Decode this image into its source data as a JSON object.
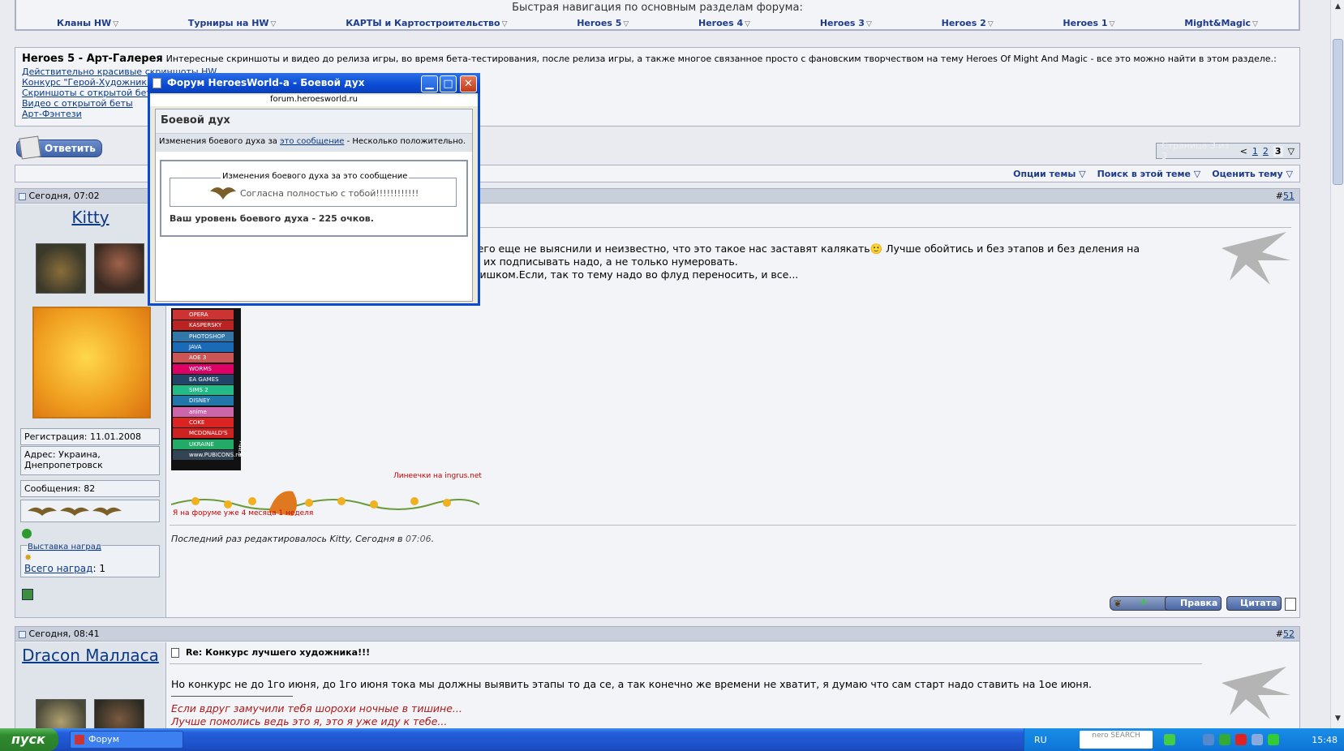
{
  "nav": {
    "title": "Быстрая навигация по основным разделам форума:",
    "links": [
      "Кланы HW",
      "Турниры на HW",
      "КАРТЫ и Картостроительство",
      "Heroes 5",
      "Heroes 4",
      "Heroes 3",
      "Heroes 2",
      "Heroes 1",
      "Might&Magic"
    ]
  },
  "forum": {
    "title": "Heroes 5 - Арт-Галерея",
    "description": "Интересные скриншоты и видео до релиза игры, во время бета-тестирования, после релиза игры, а также многое связанное просто с фановским творчеством на тему Heroes Of Might And Magic - все это можно найти в этом разделе.:",
    "links": [
      "Действительно красивые скриншоты HW",
      "Конкурс \"Герой-Художник\"",
      "Скриншоты с открытой беты",
      "Видео с открытой беты",
      "Арт-Фэнтези"
    ]
  },
  "reply_label": "Ответить",
  "pager": {
    "label": "Страница 3 из 3",
    "prev": "<",
    "pages": [
      "1",
      "2",
      "3"
    ],
    "current": "3"
  },
  "tools": [
    "Опции темы",
    "Поиск в этой теме",
    "Оценить тему"
  ],
  "post1": {
    "date": "Сегодня, 07:02",
    "index_prefix": "#",
    "index": "51",
    "username": "Kitty",
    "registration": "Регистрация: 11.01.2008",
    "address": "Адрес: Украина, Днепропетровск",
    "messages": "Сообщения: 82",
    "awards_link": "Выставка наград",
    "awards_total_label": "Всего наград",
    "awards_total": "1",
    "text_line1": "ничего еще не выяснили и неизвестно, что это такое нас заставят калякать🙂 Лучше обойтись и без этапов и без деления на",
    "text_line2": "еще их подписывать надо, а не только нумеровать.",
    "text_line3": "е слишком.Если, так то тему надо во флуд переносить, и все...",
    "sig_credit": "Линеечки на ingrus.net",
    "sig_line": "Я на форуме уже 4 месяца 1 неделя",
    "edited": "Последний раз редактировалось Kitty, Сегодня в",
    "edited_time": "07:06",
    "badges": [
      "OPERA",
      "KASPERSKY",
      "PHOTOSHOP",
      "JAVA",
      "AOE 3",
      "WORMS",
      "EA GAMES",
      "SIMS 2",
      "DISNEY",
      "anime",
      "COKE",
      "MCDONALD'S",
      "UKRAINE",
      "www.PUBICONS.ru"
    ],
    "buttons": [
      "Правка",
      "Цитата"
    ]
  },
  "post2": {
    "date": "Сегодня, 08:41",
    "index_prefix": "#",
    "index": "52",
    "username": "Dracon Малласа",
    "title": "Re: Конкурс лучшего художника!!!",
    "text": "Но конкурс не до 1го июня, до 1го июня тока мы должны выявить этапы то да се, а так конечно же времени не хватит, я думаю что сам старт надо ставить на 1ое июня.",
    "sig1": "Если вдруг замучили тебя шорохи ночные в тишине...",
    "sig2": "Лучше помолись ведь это я, это я уже иду к тебе..."
  },
  "modal": {
    "title": "Форум HeroesWorld-а - Боевой дух",
    "url": "forum.heroesworld.ru",
    "heading": "Боевой дух",
    "change_prefix": "Изменения боевого духа за",
    "change_link": "это сообщение",
    "change_suffix": "- Несколько положительно.",
    "fieldset_legend": "Изменения боевого духа за это сообщение",
    "comment": "Согласна полностью с тобой!!!!!!!!!!!!",
    "level": "Ваш уровень боевого духа - 225 очков."
  },
  "taskbar": {
    "start": "пуск",
    "task": "Форум HeroesWorld-...",
    "lang": "RU",
    "search": "nero SEARCH",
    "time": "15:48"
  }
}
